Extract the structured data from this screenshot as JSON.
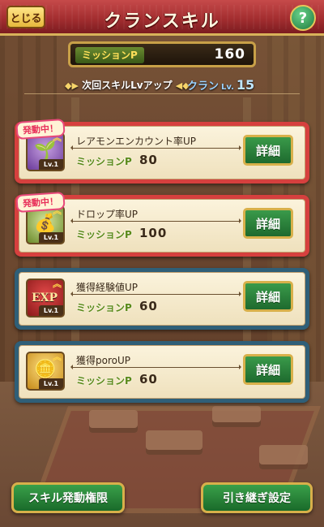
{
  "header": {
    "close_label": "とじる",
    "title": "クランスキル",
    "help_label": "?"
  },
  "mission_points": {
    "label": "ミッションP",
    "value": "160"
  },
  "next_level": {
    "text": "次回スキルLvアップ",
    "clan_label": "クラン",
    "lv_label": "Lv.",
    "lv_value": "15"
  },
  "skills": [
    {
      "name": "レアモンエンカウント率UP",
      "cost_label": "ミッションP",
      "cost": "80",
      "level": "Lv.1",
      "active": true,
      "badge": "発動中！",
      "detail_label": "詳細",
      "icon": "rare-monster-icon"
    },
    {
      "name": "ドロップ率UP",
      "cost_label": "ミッションP",
      "cost": "100",
      "level": "Lv.1",
      "active": true,
      "badge": "発動中！",
      "detail_label": "詳細",
      "icon": "drop-bag-icon"
    },
    {
      "name": "獲得経験値UP",
      "cost_label": "ミッションP",
      "cost": "60",
      "level": "Lv.1",
      "active": false,
      "icon_text": "EXP",
      "detail_label": "詳細",
      "icon": "exp-icon"
    },
    {
      "name": "獲得poroUP",
      "cost_label": "ミッションP",
      "cost": "60",
      "level": "Lv.1",
      "active": false,
      "detail_label": "詳細",
      "icon": "coin-icon"
    }
  ],
  "footer": {
    "left_label": "スキル発動権限",
    "right_label": "引き継ぎ設定"
  },
  "colors": {
    "active_border": "#d6403e",
    "inactive_border": "#2f5f78",
    "button_green": "#2a8a3a",
    "gold": "#d8b04a"
  }
}
